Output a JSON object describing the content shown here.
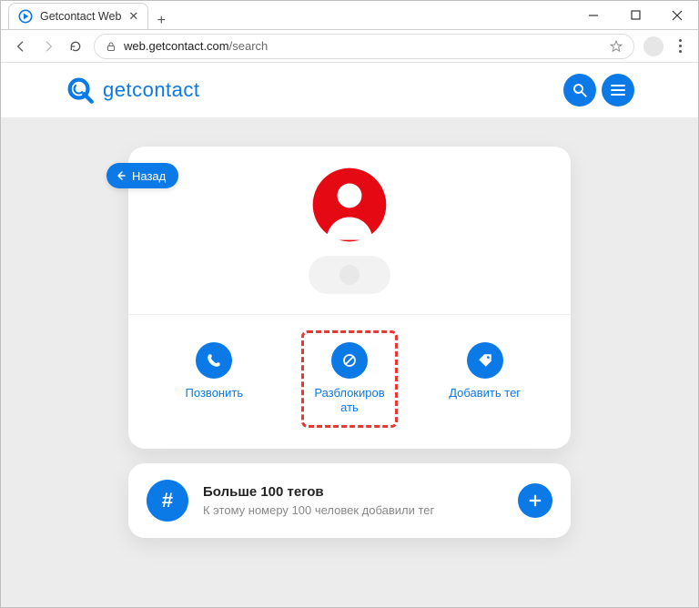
{
  "browser": {
    "tab_title": "Getcontact Web",
    "url_host": "web.getcontact.com",
    "url_path": "/search"
  },
  "appbar": {
    "brand": "getcontact"
  },
  "back": {
    "label": "Назад"
  },
  "actions": {
    "call": "Позвонить",
    "unblock": "Разблокиров ать",
    "add_tag": "Добавить тег"
  },
  "tags": {
    "title": "Больше 100 тегов",
    "subtitle": "К этому номеру 100 человек добавили тег"
  }
}
